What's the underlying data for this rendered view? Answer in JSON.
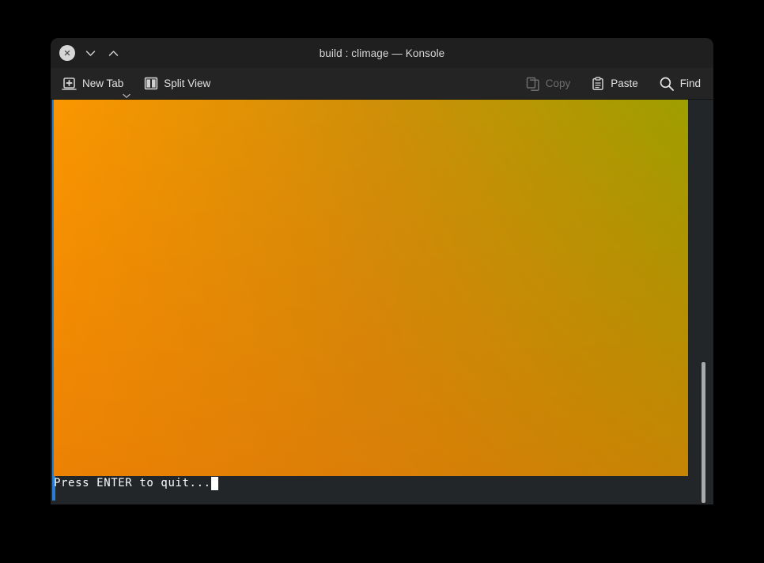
{
  "window": {
    "title": "build : climage — Konsole",
    "controls": {
      "close": "close-button",
      "next": "next-button",
      "previous": "previous-button"
    }
  },
  "toolbar": {
    "new_tab_label": "New Tab",
    "split_view_label": "Split View",
    "copy_label": "Copy",
    "copy_enabled": false,
    "paste_label": "Paste",
    "find_label": "Find"
  },
  "terminal": {
    "prompt_text": "Press ENTER to quit...",
    "cursor": "block",
    "background": "#232629",
    "foreground": "#fcfcfc",
    "marker_color": "#2a7fd4"
  },
  "image": {
    "description": "CLImage rendered color gradient",
    "corner_colors": {
      "top_left": "#fa9600",
      "top_right": "#9e9e00",
      "bottom_left": "#fc7f07",
      "bottom_right": "#998000"
    },
    "center_color": "#d08f08"
  },
  "scrollbar": {
    "thumb_color": "#a9a9a9",
    "position": "bottom"
  }
}
